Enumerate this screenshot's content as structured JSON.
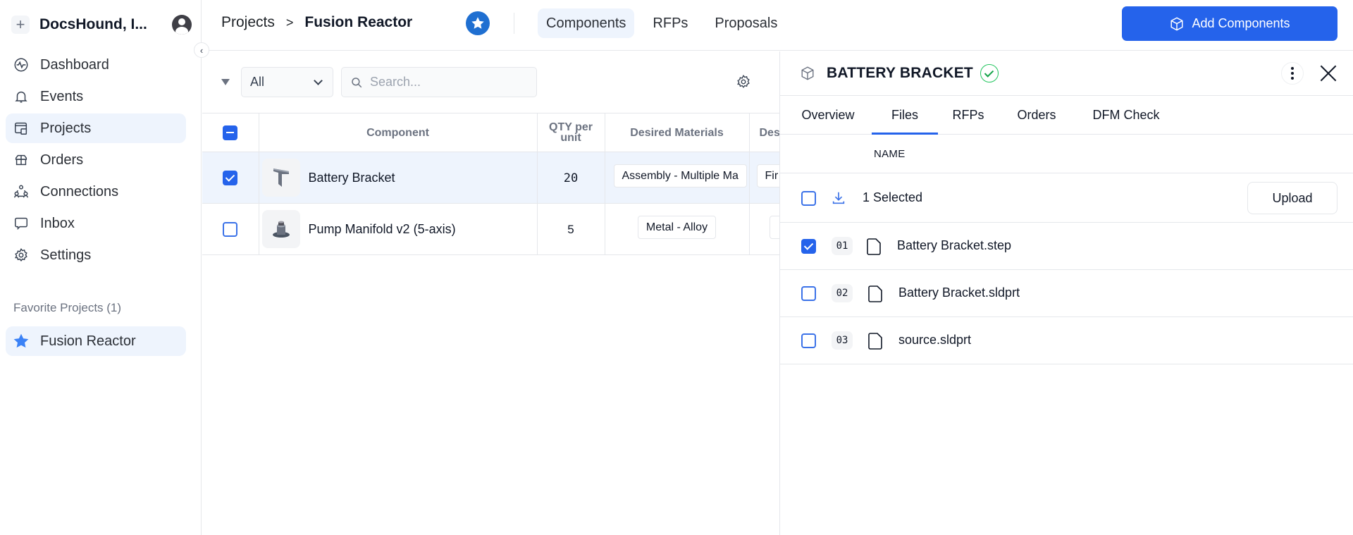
{
  "sidebar": {
    "org_name": "DocsHound, I...",
    "nav": [
      {
        "label": "Dashboard",
        "icon": "activity-icon"
      },
      {
        "label": "Events",
        "icon": "bell-icon"
      },
      {
        "label": "Projects",
        "icon": "projects-icon",
        "active": true
      },
      {
        "label": "Orders",
        "icon": "orders-icon"
      },
      {
        "label": "Connections",
        "icon": "connections-icon"
      },
      {
        "label": "Inbox",
        "icon": "message-icon"
      },
      {
        "label": "Settings",
        "icon": "gear-icon"
      }
    ],
    "favorites_title": "Favorite Projects (1)",
    "favorites": [
      {
        "label": "Fusion Reactor",
        "icon": "star-icon"
      }
    ]
  },
  "header": {
    "breadcrumb": [
      "Projects",
      "Fusion Reactor"
    ],
    "breadcrumb_sep": ">",
    "tabs": [
      {
        "label": "Components",
        "active": true
      },
      {
        "label": "RFPs"
      },
      {
        "label": "Proposals"
      }
    ],
    "add_button": "Add Components",
    "accent_color": "#2563eb"
  },
  "toolbar": {
    "filter_value": "All",
    "search_placeholder": "Search..."
  },
  "table": {
    "columns": [
      "Component",
      "QTY per unit",
      "Desired Materials",
      "Des"
    ],
    "rows": [
      {
        "name": "Battery Bracket",
        "qty": "20",
        "material": "Assembly - Multiple Ma",
        "next": "Fir",
        "selected": true
      },
      {
        "name": "Pump Manifold v2 (5-axis)",
        "qty": "5",
        "material": "Metal - Alloy",
        "next": "",
        "selected": false
      }
    ]
  },
  "panel": {
    "title": "BATTERY BRACKET",
    "status": "verified",
    "tabs": [
      {
        "label": "Overview"
      },
      {
        "label": "Files",
        "active": true
      },
      {
        "label": "RFPs"
      },
      {
        "label": "Orders"
      },
      {
        "label": "DFM Check"
      }
    ],
    "column_name": "NAME",
    "selected_count": "1 Selected",
    "upload_label": "Upload",
    "files": [
      {
        "index": "01",
        "name": "Battery Bracket.step",
        "checked": true
      },
      {
        "index": "02",
        "name": "Battery Bracket.sldprt",
        "checked": false
      },
      {
        "index": "03",
        "name": "source.sldprt",
        "checked": false
      }
    ]
  }
}
